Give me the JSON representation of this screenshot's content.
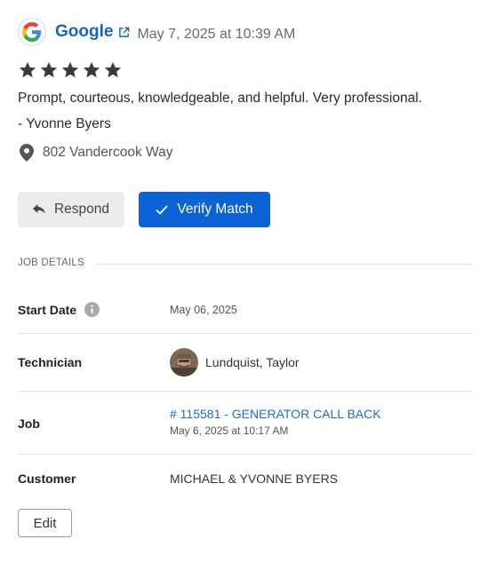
{
  "review": {
    "source": "Google",
    "date": "May 7, 2025 at 10:39 AM",
    "rating": 5,
    "text": "Prompt, courteous, knowledgeable, and helpful. Very professional.",
    "reviewer": "- Yvonne Byers",
    "address": "802 Vandercook Way"
  },
  "actions": {
    "respond_label": "Respond",
    "verify_label": "Verify Match"
  },
  "job_details": {
    "section_title": "JOB DETAILS",
    "start_date_label": "Start Date",
    "start_date_value": "May 06, 2025",
    "technician_label": "Technician",
    "technician_name": "Lundquist, Taylor",
    "job_label": "Job",
    "job_link": "# 115581 - GENERATOR CALL BACK",
    "job_date": "May 6, 2025 at 10:17 AM",
    "customer_label": "Customer",
    "customer_value": "MICHAEL & YVONNE BYERS"
  },
  "edit_label": "Edit",
  "icons": {
    "source_logo": "google-logo",
    "external": "external-link-icon",
    "star": "star-icon",
    "location": "map-pin-icon",
    "respond": "reply-icon",
    "verify": "check-icon",
    "info": "info-icon"
  },
  "colors": {
    "accent": "#0b63d6",
    "link": "#1565c8",
    "star": "#3a3a3a"
  }
}
